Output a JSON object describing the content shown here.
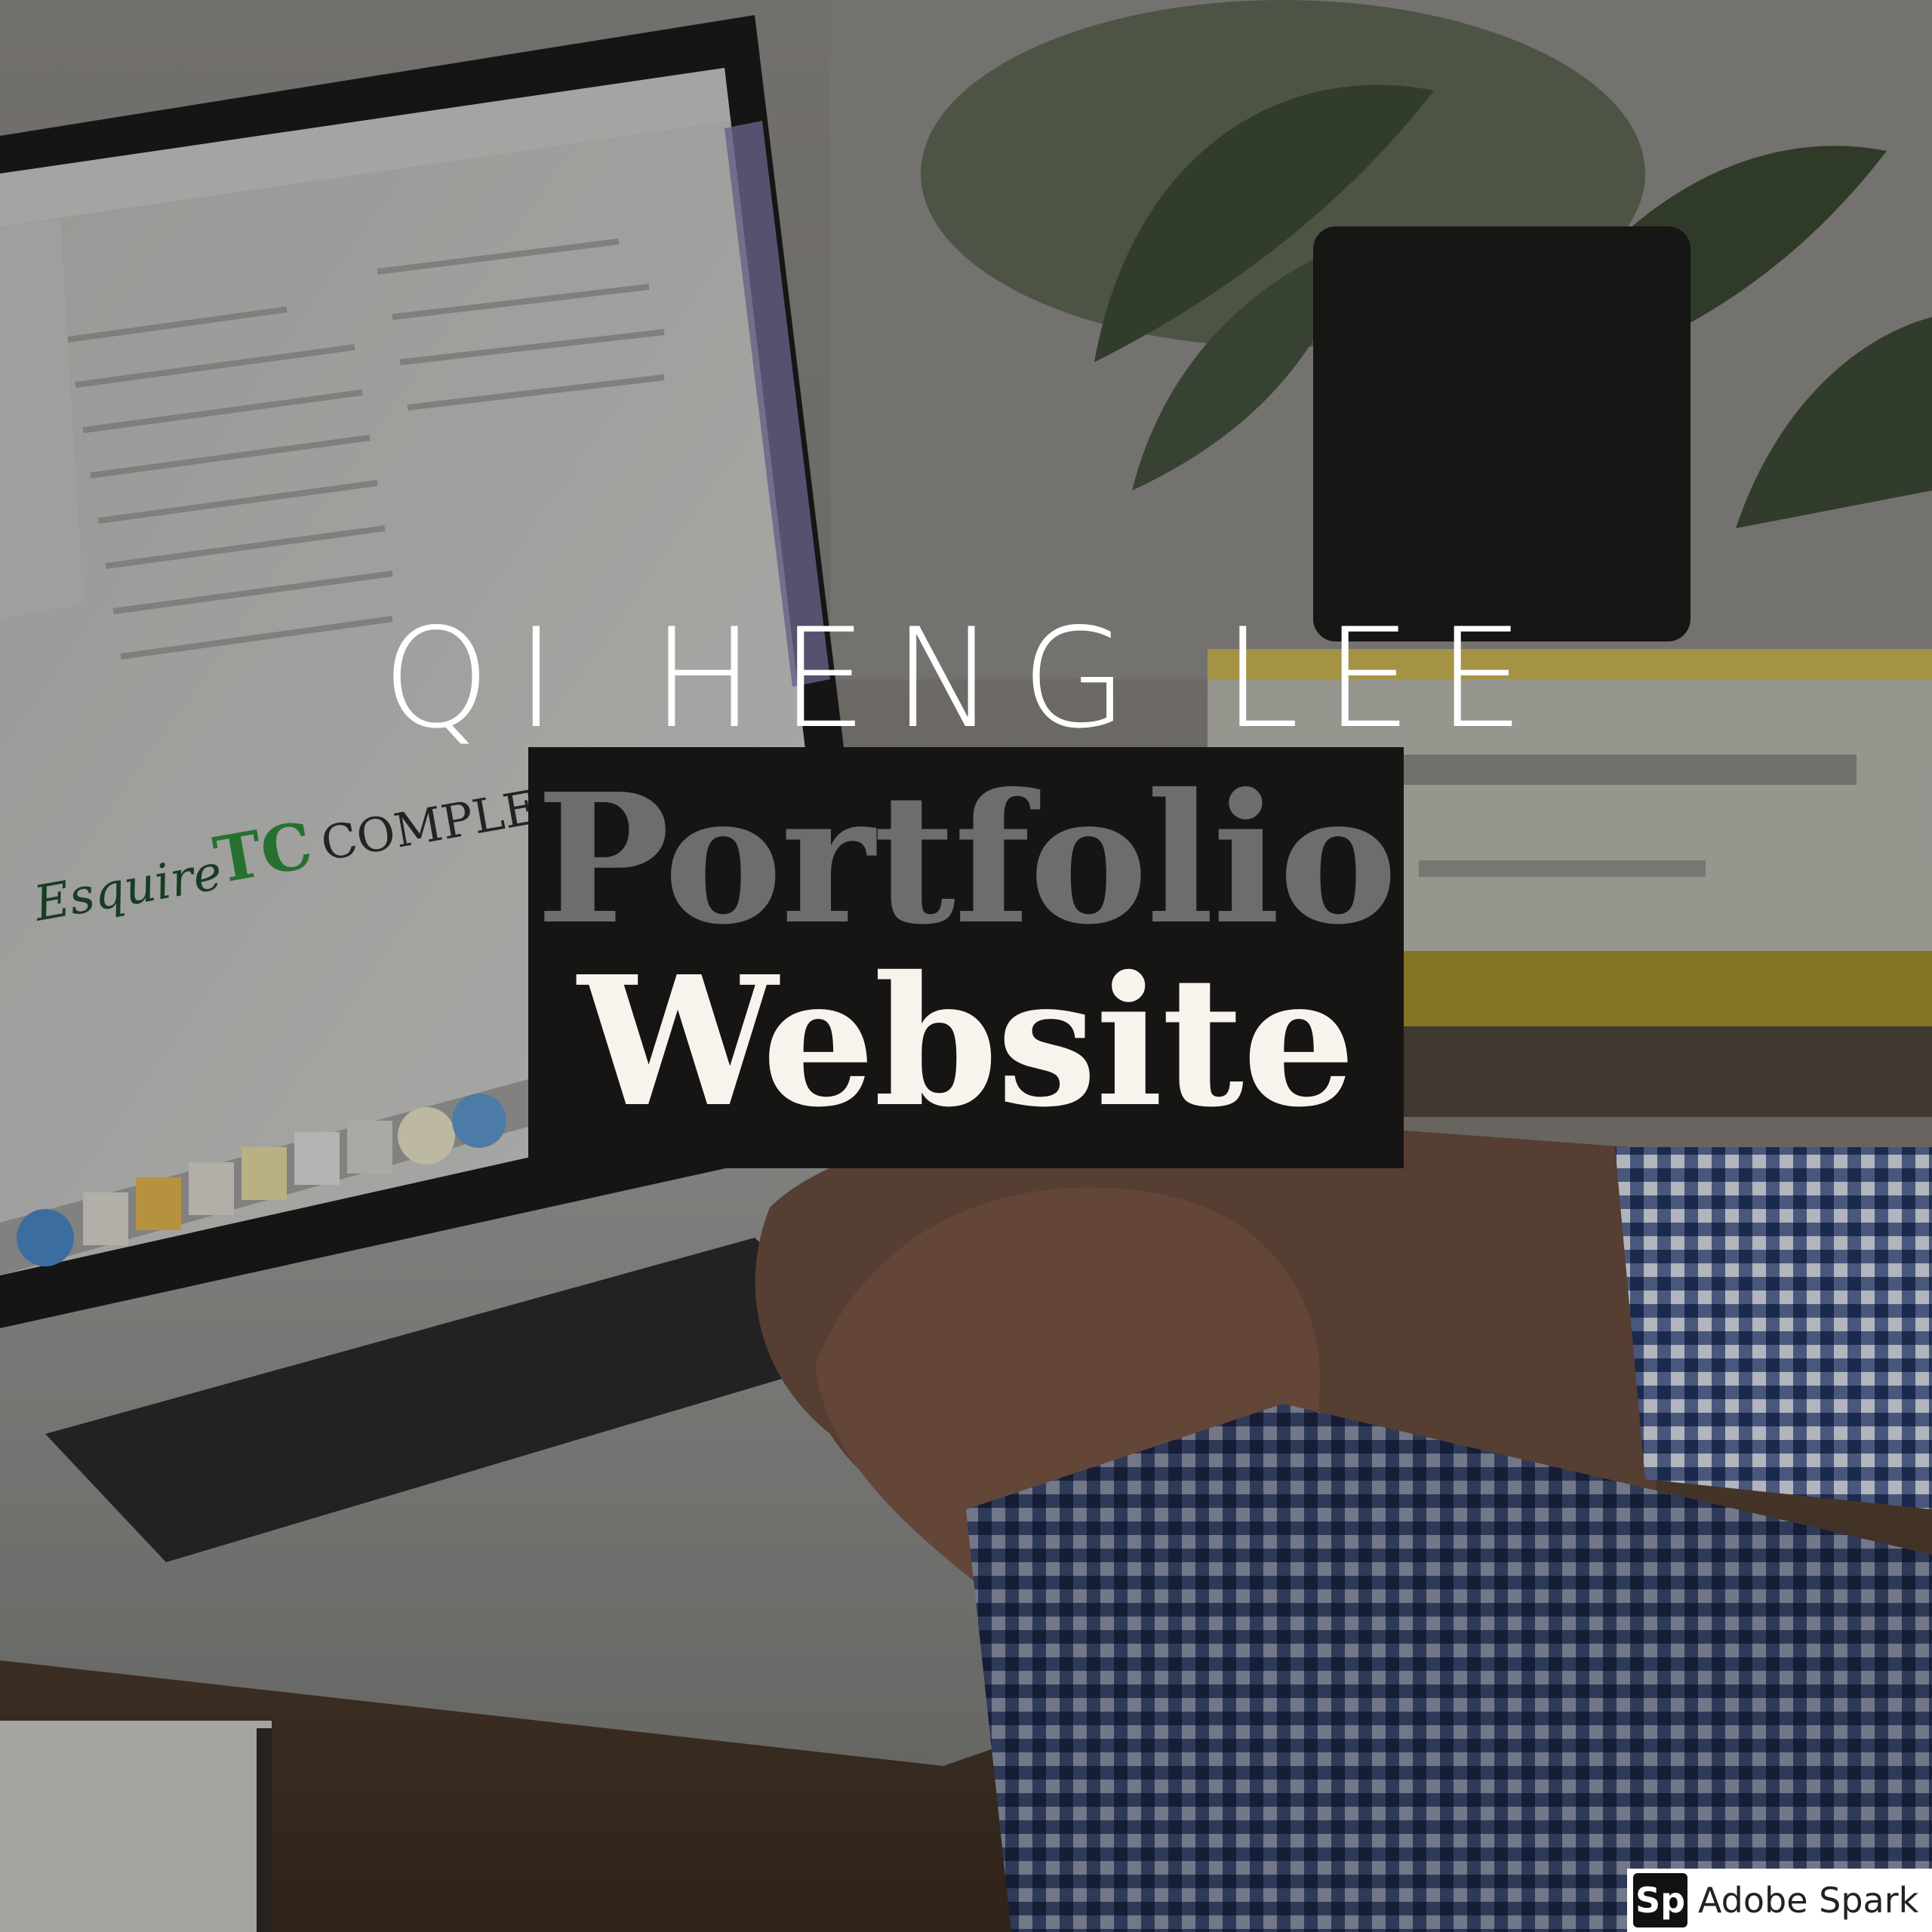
{
  "heading": {
    "name": "QI HENG LEE",
    "title_line1": "Portfolio",
    "title_line2": "Website"
  },
  "watermark": {
    "logo": "Sp",
    "text": "Adobe Spark"
  },
  "photo": {
    "laptop_screen_logos": [
      "Esquire",
      "TC",
      "COMPLEX"
    ]
  }
}
